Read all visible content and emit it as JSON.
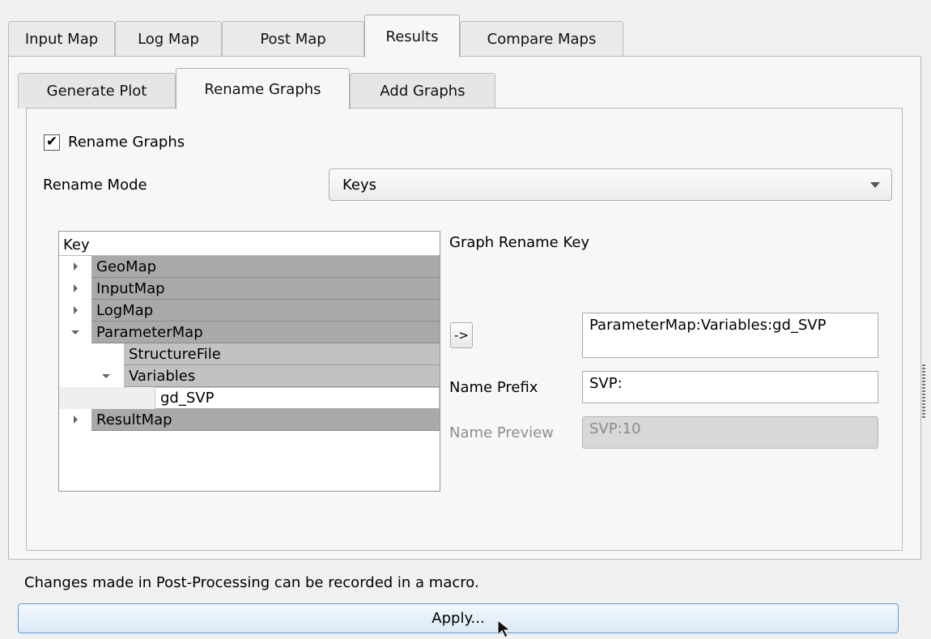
{
  "outer_tabs": [
    {
      "label": "Input Map"
    },
    {
      "label": "Log Map"
    },
    {
      "label": "Post Map"
    },
    {
      "label": "Results",
      "active": true
    },
    {
      "label": "Compare Maps"
    }
  ],
  "inner_tabs": [
    {
      "label": "Generate Plot"
    },
    {
      "label": "Rename Graphs",
      "active": true
    },
    {
      "label": "Add Graphs"
    }
  ],
  "rename_checkbox": {
    "label": "Rename Graphs",
    "checked": true,
    "mark": "✔"
  },
  "rename_mode": {
    "label": "Rename Mode",
    "value": "Keys"
  },
  "tree": {
    "header": "Key",
    "rows": [
      {
        "label": "GeoMap",
        "state": "collapsed"
      },
      {
        "label": "InputMap",
        "state": "collapsed"
      },
      {
        "label": "LogMap",
        "state": "collapsed"
      },
      {
        "label": "ParameterMap",
        "state": "expanded"
      },
      {
        "label": "StructureFile",
        "state": "leaf"
      },
      {
        "label": "Variables",
        "state": "expanded"
      },
      {
        "label": "gd_SVP",
        "state": "leaf",
        "selected": true
      },
      {
        "label": "ResultMap",
        "state": "collapsed"
      }
    ]
  },
  "graph_rename_key": {
    "label": "Graph Rename Key",
    "arrow_button": "->",
    "value": "ParameterMap:Variables:gd_SVP"
  },
  "name_prefix": {
    "label": "Name Prefix",
    "value": "SVP:"
  },
  "name_preview": {
    "label": "Name Preview",
    "value": "SVP:10"
  },
  "footer": {
    "note": "Changes made in Post-Processing can be recorded in a macro.",
    "apply_label": "Apply..."
  },
  "colors": {
    "accent_border": "#5b9ad6",
    "tree_dark": "#a9a9a9",
    "tree_mid": "#c2c2c2"
  }
}
